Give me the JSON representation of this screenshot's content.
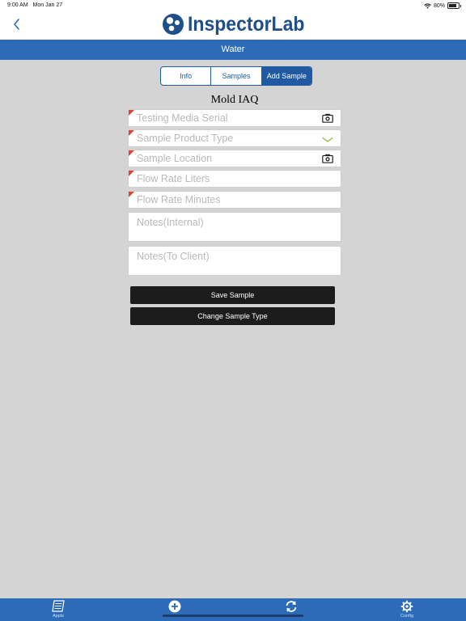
{
  "status_bar": {
    "time": "9:00 AM",
    "date": "Mon Jan 27",
    "battery": "80%"
  },
  "header": {
    "logo_text": "InspectorLab",
    "title": "Water"
  },
  "segments": [
    {
      "label": "Info",
      "active": false
    },
    {
      "label": "Samples",
      "active": false
    },
    {
      "label": "Add Sample",
      "active": true
    }
  ],
  "form": {
    "title": "Mold IAQ",
    "fields": {
      "testing_media_serial": {
        "placeholder": "Testing Media Serial",
        "required": true,
        "icon": "camera-icon"
      },
      "sample_product_type": {
        "placeholder": "Sample Product Type",
        "required": true,
        "icon": "chevron-down-icon"
      },
      "sample_location": {
        "placeholder": "Sample Location",
        "required": true,
        "icon": "camera-icon"
      },
      "flow_rate_liters": {
        "placeholder": "Flow Rate Liters",
        "required": true
      },
      "flow_rate_minutes": {
        "placeholder": "Flow Rate Minutes",
        "required": true
      },
      "notes_internal": {
        "placeholder": "Notes(Internal)"
      },
      "notes_client": {
        "placeholder": "Notes(To Client)"
      }
    },
    "save_button": "Save Sample",
    "change_type_button": "Change Sample Type"
  },
  "tab_bar": {
    "appts": "Appts",
    "add": "",
    "sync": "",
    "config": "Config"
  },
  "colors": {
    "brand_blue": "#2b6bb7",
    "logo_blue": "#1e4f8a",
    "required_marker": "#e8402e",
    "background": "#d4d4d4"
  }
}
